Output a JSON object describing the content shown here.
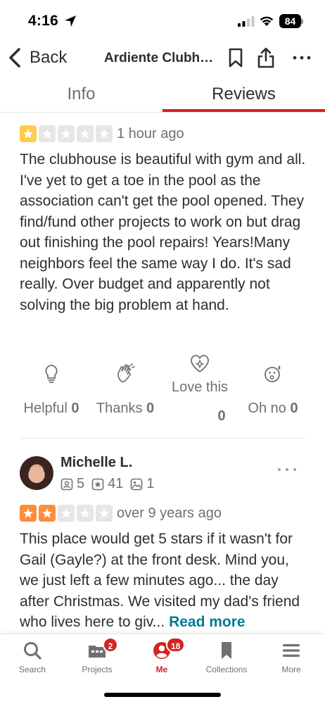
{
  "status_bar": {
    "time": "4:16",
    "battery": "84"
  },
  "nav": {
    "back_label": "Back",
    "title": "Ardiente Clubhouse"
  },
  "tabs": [
    {
      "label": "Info"
    },
    {
      "label": "Reviews"
    }
  ],
  "reviews": [
    {
      "rating": 1,
      "time": "1 hour ago",
      "text": "The clubhouse is beautiful with gym and all.  I've yet to get a toe in the pool as the association can't get the pool opened.  They find/fund other projects to work on but drag out finishing the pool repairs!  Years!Many neighbors feel the same way I do.  It's sad really.  Over budget and apparently not solving the big problem at hand.",
      "reactions": [
        {
          "label": "Helpful",
          "count": "0",
          "icon": "lightbulb-icon"
        },
        {
          "label": "Thanks",
          "count": "0",
          "icon": "clapping-hands-icon"
        },
        {
          "label": "Love this",
          "count": "0",
          "icon": "heart-sparkle-icon"
        },
        {
          "label": "Oh no",
          "count": "0",
          "icon": "surprised-face-icon"
        }
      ]
    },
    {
      "reviewer": {
        "name": "Michelle L.",
        "friends": "5",
        "reviews": "41",
        "photos": "1"
      },
      "rating": 2,
      "time": "over 9 years ago",
      "text": "This place would get 5 stars if it wasn't for Gail (Gayle?) at the front desk. Mind you, we just left a few minutes ago... the day after Christmas. We visited my dad's friend who lives here to giv...",
      "read_more": "Read more"
    }
  ],
  "tabbar": [
    {
      "label": "Search",
      "icon": "search-icon"
    },
    {
      "label": "Projects",
      "icon": "projects-icon",
      "badge": "2"
    },
    {
      "label": "Me",
      "icon": "me-icon",
      "badge": "18",
      "active": true
    },
    {
      "label": "Collections",
      "icon": "bookmark-icon"
    },
    {
      "label": "More",
      "icon": "menu-icon"
    }
  ],
  "colors": {
    "accent": "#d32323",
    "star_one": "#ffcc4b",
    "star_two": "#ff8c3a",
    "star_empty": "#e6e6e6",
    "link": "#027a97"
  }
}
